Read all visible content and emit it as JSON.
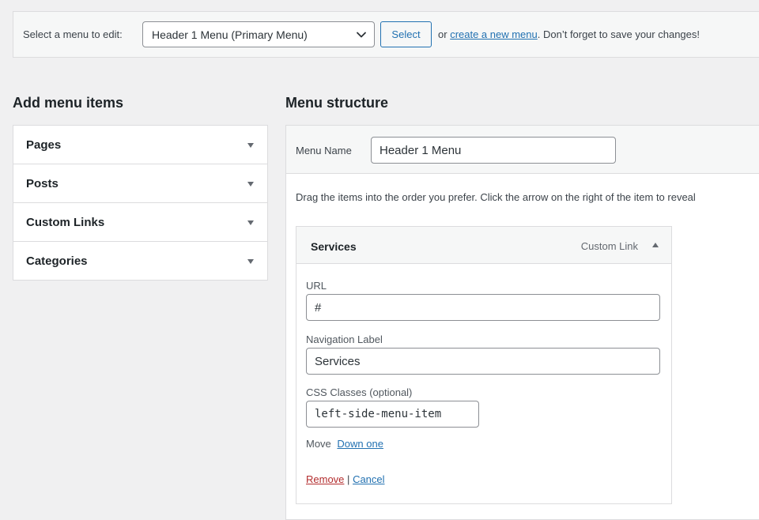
{
  "top_bar": {
    "label": "Select a menu to edit:",
    "selected_menu": "Header 1 Menu (Primary Menu)",
    "select_button": "Select",
    "or_text": "or",
    "create_link": "create a new menu",
    "tail_text": ". Don’t forget to save your changes!"
  },
  "left": {
    "heading": "Add menu items",
    "sections": [
      {
        "title": "Pages"
      },
      {
        "title": "Posts"
      },
      {
        "title": "Custom Links"
      },
      {
        "title": "Categories"
      }
    ]
  },
  "right": {
    "heading": "Menu structure",
    "menu_name_label": "Menu Name",
    "menu_name_value": "Header 1 Menu",
    "instructions": "Drag the items into the order you prefer. Click the arrow on the right of the item to reveal",
    "item": {
      "title": "Services",
      "type": "Custom Link",
      "url_label": "URL",
      "url_value": "#",
      "nav_label_label": "Navigation Label",
      "nav_label_value": "Services",
      "css_label": "CSS Classes (optional)",
      "css_value": "left-side-menu-item",
      "move_label": "Move",
      "move_link": "Down one",
      "remove_link": "Remove",
      "separator": "|",
      "cancel_link": "Cancel"
    }
  },
  "colors": {
    "accent": "#2271b1",
    "danger": "#b32d2e",
    "background": "#f0f0f1"
  }
}
